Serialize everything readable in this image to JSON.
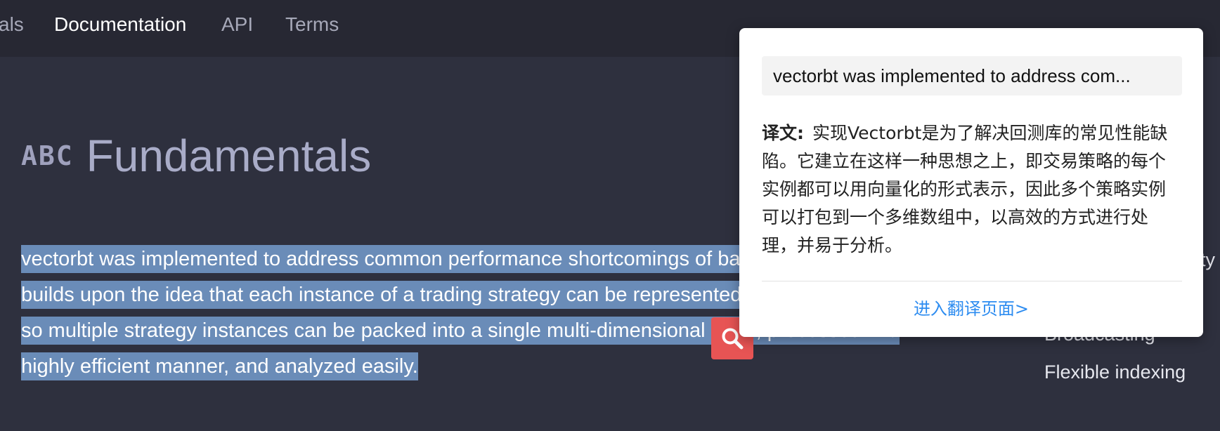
{
  "nav": {
    "items": [
      {
        "label": "als",
        "active": false
      },
      {
        "label": "Documentation",
        "active": true
      },
      {
        "label": "API",
        "active": false
      },
      {
        "label": "Terms",
        "active": false
      }
    ]
  },
  "page": {
    "icon": "abc-icon",
    "icon_text": "ABC",
    "title": "Fundamentals"
  },
  "content": {
    "paragraph": "vectorbt was implemented to address common performance shortcomings of backtesting libraries. It builds upon the idea that each instance of a trading strategy can be represented in a vectorized form, so multiple strategy instances can be packed into a single multi-dimensional array, processed in a highly efficient manner, and analyzed easily."
  },
  "sidebar": {
    "fragment": "ty",
    "items": [
      "Broadcasting",
      "Flexible indexing"
    ]
  },
  "search_button": {
    "icon": "search-icon",
    "color": "#e75454"
  },
  "popup": {
    "query": "vectorbt was implemented to address com...",
    "label": "译文:",
    "translation": "实现Vectorbt是为了解决回测库的常见性能缺陷。它建立在这样一种思想之上，即交易策略的每个实例都可以用向量化的形式表示，因此多个策略实例可以打包到一个多维数组中，以高效的方式进行处理，并易于分析。",
    "link": "进入翻译页面>",
    "link_color": "#2d8cf0"
  },
  "colors": {
    "background": "#2e303e",
    "nav_background": "#272833",
    "selection": "#6a8cb8"
  }
}
